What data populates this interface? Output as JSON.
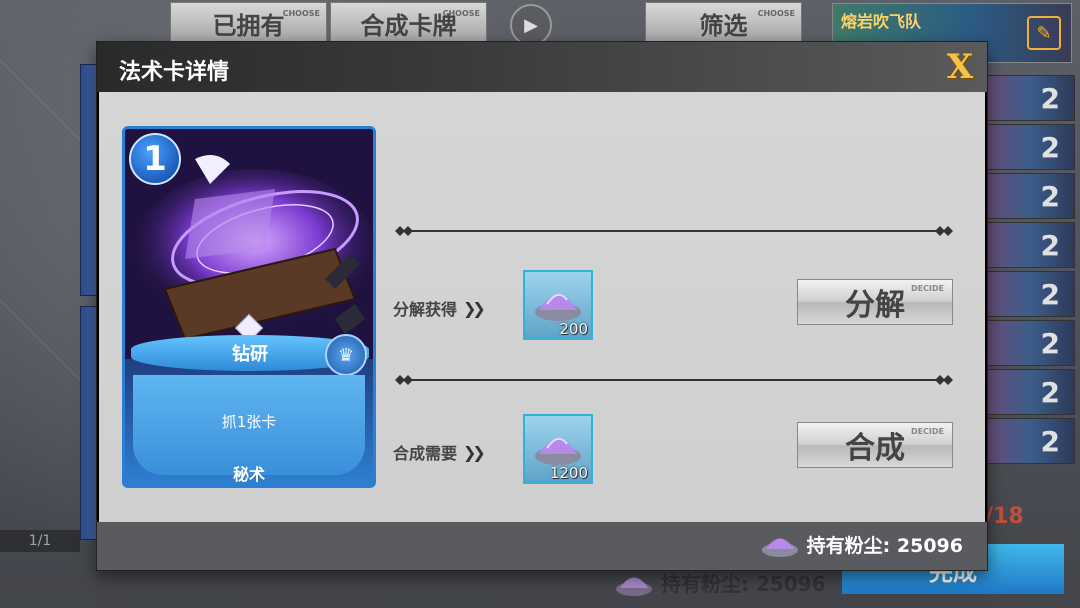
{
  "background": {
    "tabs": [
      {
        "label": "已拥有",
        "tag": "CHOOSE"
      },
      {
        "label": "合成卡牌",
        "tag": "CHOOSE"
      },
      {
        "label": "筛选",
        "tag": "CHOOSE"
      }
    ],
    "play_label": "▶",
    "deck_name": "熔岩吹飞队",
    "deck_counts": [
      "2",
      "2",
      "2",
      "2",
      "2",
      "2",
      "2",
      "2"
    ],
    "pager": "1/1",
    "card_count": "/18",
    "dust_text": "持有粉尘: 25096",
    "done_label": "完成"
  },
  "modal": {
    "title": "法术卡详情",
    "close_label": "X",
    "card": {
      "cost": "1",
      "name": "钻研",
      "description": "抓1张卡",
      "type": "秘术"
    },
    "decompose": {
      "label": "分解获得",
      "dust_amount": "200",
      "button_label": "分解",
      "button_tag": "DECIDE"
    },
    "craft": {
      "label": "合成需要",
      "dust_amount": "1200",
      "button_label": "合成",
      "button_tag": "DECIDE"
    },
    "footer_dust": "持有粉尘: 25096"
  },
  "colors": {
    "accent_gold": "#f5c34a",
    "card_blue": "#2a7ed4",
    "dust_purple": "#b68ae8"
  }
}
